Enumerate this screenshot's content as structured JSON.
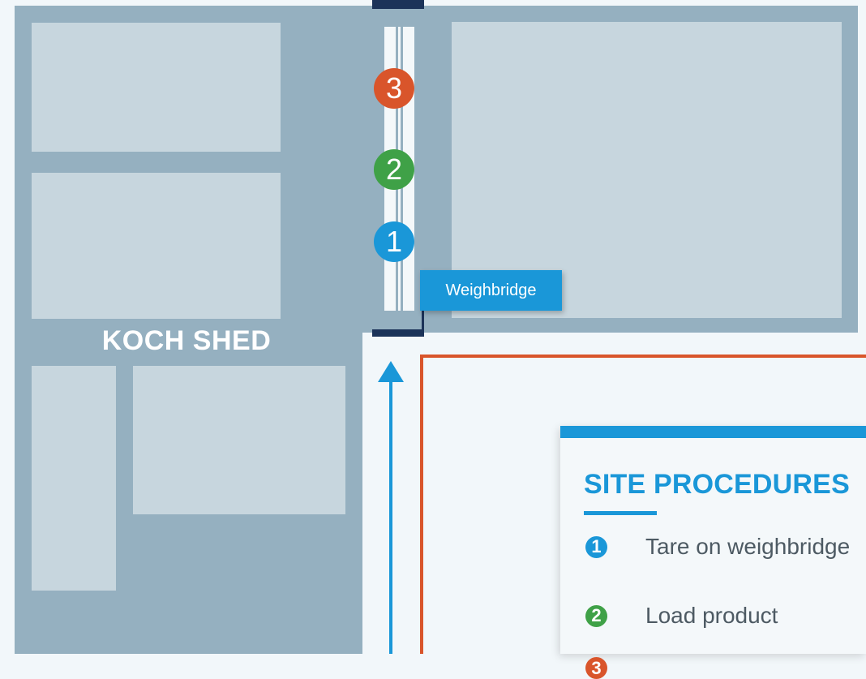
{
  "map": {
    "shed_label": "KOCH SHED",
    "weighbridge_label": "Weighbridge",
    "step_markers": [
      {
        "num": "3",
        "color": "#d9552b"
      },
      {
        "num": "2",
        "color": "#3fa147"
      },
      {
        "num": "1",
        "color": "#1a97d8"
      }
    ]
  },
  "panel": {
    "title": "SITE PROCEDURES",
    "items": [
      {
        "num": "1",
        "text": "Tare on weighbridge",
        "color": "#1a97d8"
      },
      {
        "num": "2",
        "text": "Load product",
        "color": "#3fa147"
      },
      {
        "num": "3",
        "text": "",
        "color": "#d9552b"
      }
    ]
  },
  "colors": {
    "shed": "#95b0c0",
    "room": "#c7d6de",
    "route": "#1a97d8",
    "zone_border": "#d9552b",
    "gate": "#1c3359"
  }
}
